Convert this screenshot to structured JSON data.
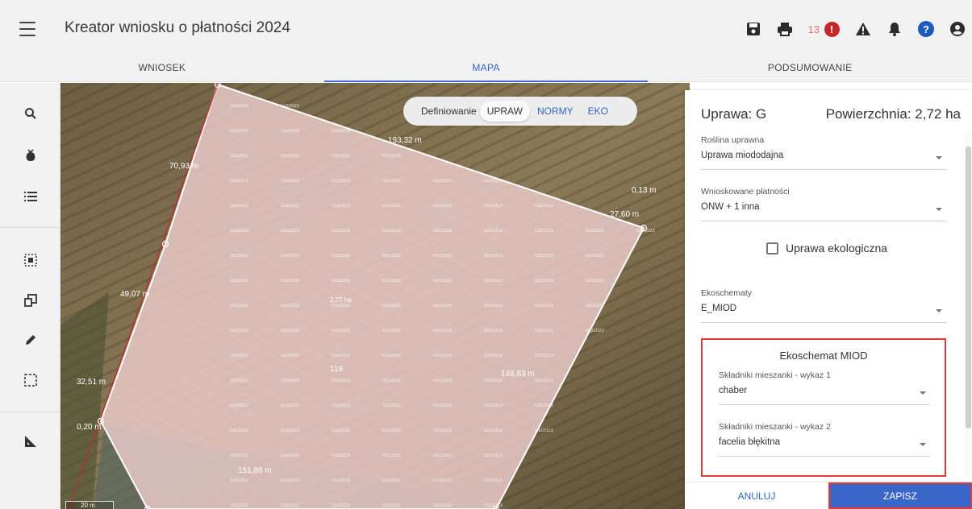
{
  "app": {
    "title": "Kreator wniosku o płatności 2024",
    "alert_count": "13"
  },
  "tabs": [
    {
      "label": "WNIOSEK"
    },
    {
      "label": "MAPA"
    },
    {
      "label": "PODSUMOWANIE"
    }
  ],
  "map": {
    "mode_label": "Definiowanie",
    "modes": [
      "UPRAW",
      "NORMY",
      "EKO"
    ],
    "active_mode": "UPRAW",
    "scale": "20 m",
    "watermark": "GO2023",
    "area_label": "2,72 ha",
    "segment_labels": [
      "193,32 m",
      "70,93 m",
      "0,13 m",
      "27,60 m",
      "49,07 m",
      "148,63 m",
      "32,51 m",
      "0,20 m",
      "151,89 m",
      "119"
    ]
  },
  "panel": {
    "title": "Uprawa: G",
    "area": "Powierzchnia: 2,72 ha",
    "fields": [
      {
        "label": "Roślina uprawna",
        "value": "Uprawa miododajna"
      },
      {
        "label": "Wnioskowane płatności",
        "value": "ONW + 1 inna"
      },
      {
        "label": "Ekoschematy",
        "value": "E_MIOD"
      }
    ],
    "checkbox_label": "Uprawa ekologiczna",
    "eko": {
      "title": "Ekoschemat MIOD",
      "fields": [
        {
          "label": "Składniki mieszanki - wykaz 1",
          "value": "chaber"
        },
        {
          "label": "Składniki mieszanki - wykaz 2",
          "value": "facelia błękitna"
        }
      ]
    },
    "cancel_label": "ANULUJ",
    "save_label": "ZAPISZ"
  }
}
